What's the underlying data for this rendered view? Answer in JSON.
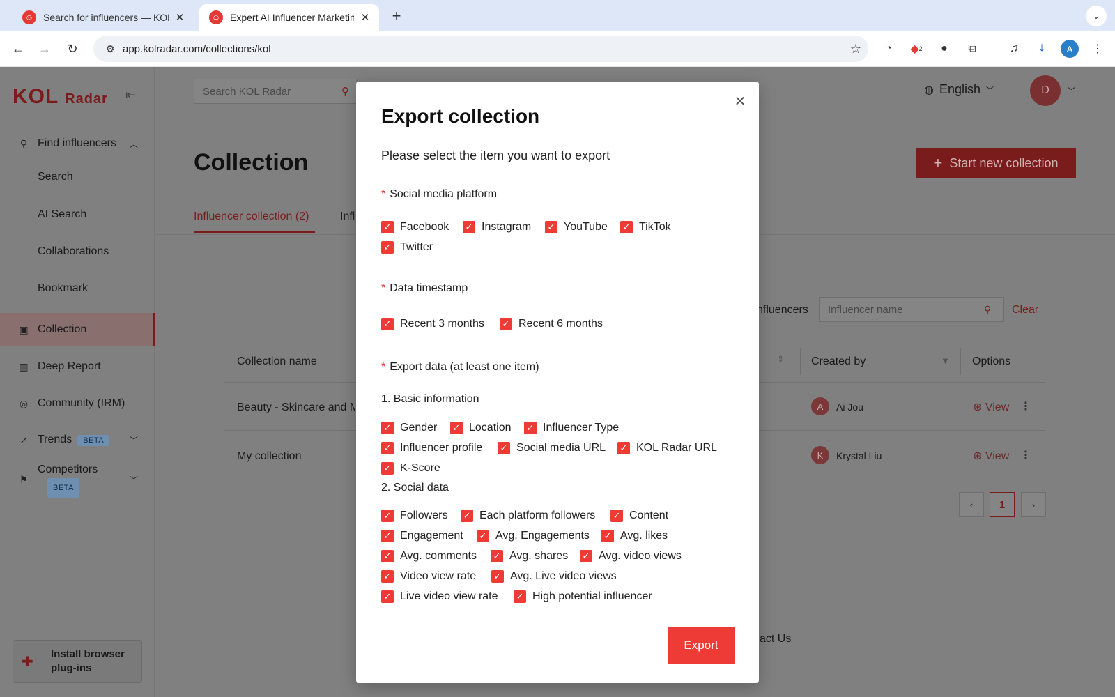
{
  "browser": {
    "tabs": [
      {
        "title": "Search for influencers — KOL Radar"
      },
      {
        "title": "Expert AI Influencer Marketing"
      }
    ],
    "new_tab": "+",
    "url": "app.kolradar.com/collections/kol",
    "ext_badge": "2",
    "profile_letter": "A"
  },
  "app": {
    "logo_main": "KOL",
    "logo_sub": "Radar",
    "search_placeholder": "Search KOL Radar",
    "language": "English",
    "user_initial": "D",
    "sidebar": {
      "find_influencers": "Find influencers",
      "search": "Search",
      "ai_search": "AI Search",
      "collaborations": "Collaborations",
      "bookmark": "Bookmark",
      "collection": "Collection",
      "deep_report": "Deep Report",
      "community": "Community (IRM)",
      "trends": "Trends",
      "competitors": "Competitors",
      "beta": "BETA",
      "plugin_line1": "Install browser",
      "plugin_line2": "plug-ins"
    },
    "page_title": "Collection",
    "start_button": "Start new collection",
    "tabs": {
      "influencer_collection": "Influencer collection (2)",
      "other": "Infl"
    },
    "filter_label": "nfluencers",
    "influencer_placeholder": "Influencer name",
    "clear": "Clear",
    "table": {
      "headers": {
        "name": "Collection name",
        "created_by": "Created by",
        "options": "Options"
      },
      "rows": [
        {
          "name": "Beauty - Skincare and M",
          "creator_initial": "A",
          "creator": "Ai Jou",
          "view": "View"
        },
        {
          "name": "My collection",
          "creator_initial": "K",
          "creator": "Krystal Liu",
          "view": "View"
        }
      ]
    },
    "pagination": {
      "current": "1"
    },
    "contact": "act Us"
  },
  "modal": {
    "title": "Export collection",
    "subtitle": "Please select the item you want to export",
    "platform_label": "Social media platform",
    "platforms": [
      "Facebook",
      "Instagram",
      "YouTube",
      "TikTok",
      "Twitter"
    ],
    "timestamp_label": "Data timestamp",
    "timestamps": [
      "Recent 3 months",
      "Recent 6 months"
    ],
    "export_label": "Export data (at least one item)",
    "basic_label": "1. Basic information",
    "basic": [
      "Gender",
      "Location",
      "Influencer Type",
      "Influencer profile",
      "Social media URL",
      "KOL Radar URL",
      "K-Score"
    ],
    "social_label": "2. Social data",
    "social": [
      "Followers",
      "Each platform followers",
      "Content",
      "Engagement",
      "Avg. Engagements",
      "Avg. likes",
      "Avg. comments",
      "Avg. shares",
      "Avg. video views",
      "Video view rate",
      "Avg. Live video views",
      "Live video view rate",
      "High potential influencer"
    ],
    "export_button": "Export"
  }
}
